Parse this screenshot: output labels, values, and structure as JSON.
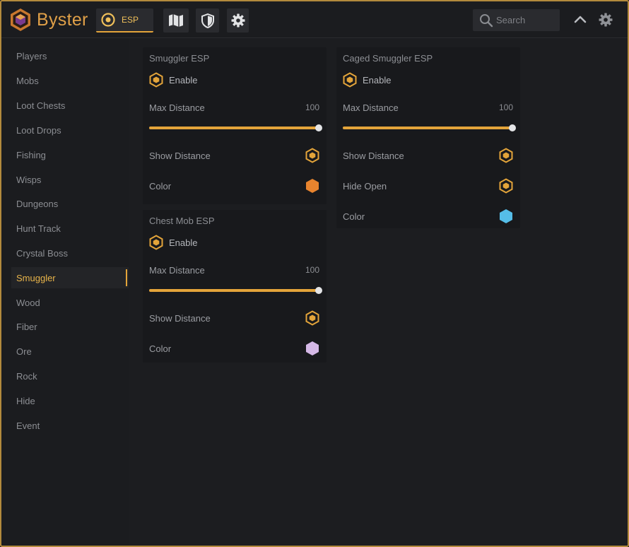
{
  "app": {
    "brand": "Byster"
  },
  "header": {
    "tabs": [
      {
        "label": "ESP",
        "icon": "eye-icon",
        "active": true
      },
      {
        "label": "",
        "icon": "map-icon"
      },
      {
        "label": "",
        "icon": "shield-icon"
      },
      {
        "label": "",
        "icon": "gear-icon"
      }
    ],
    "search": {
      "placeholder": "Search",
      "value": ""
    }
  },
  "sidebar": {
    "items": [
      {
        "label": "Players"
      },
      {
        "label": "Mobs"
      },
      {
        "label": "Loot Chests"
      },
      {
        "label": "Loot Drops"
      },
      {
        "label": "Fishing"
      },
      {
        "label": "Wisps"
      },
      {
        "label": "Dungeons"
      },
      {
        "label": "Hunt Track"
      },
      {
        "label": "Crystal Boss"
      },
      {
        "label": "Smuggler",
        "active": true
      },
      {
        "label": "Wood"
      },
      {
        "label": "Fiber"
      },
      {
        "label": "Ore"
      },
      {
        "label": "Rock"
      },
      {
        "label": "Hide"
      },
      {
        "label": "Event"
      }
    ]
  },
  "panels": {
    "smuggler_esp": {
      "title": "Smuggler ESP",
      "enable_label": "Enable",
      "enabled": true,
      "max_distance_label": "Max Distance",
      "max_distance_value": "100",
      "max_distance_fraction": 1.0,
      "show_distance_label": "Show Distance",
      "show_distance": true,
      "color_label": "Color",
      "color": "#e8842e"
    },
    "chest_mob_esp": {
      "title": "Chest Mob ESP",
      "enable_label": "Enable",
      "enabled": true,
      "max_distance_label": "Max Distance",
      "max_distance_value": "100",
      "max_distance_fraction": 1.0,
      "show_distance_label": "Show Distance",
      "show_distance": true,
      "color_label": "Color",
      "color": "#d4b8e6"
    },
    "caged_smuggler_esp": {
      "title": "Caged Smuggler ESP",
      "enable_label": "Enable",
      "enabled": true,
      "max_distance_label": "Max Distance",
      "max_distance_value": "100",
      "max_distance_fraction": 1.0,
      "show_distance_label": "Show Distance",
      "show_distance": true,
      "hide_open_label": "Hide Open",
      "hide_open": true,
      "color_label": "Color",
      "color": "#55bde8"
    }
  },
  "colors": {
    "accent": "#e3a43a",
    "border": "#b38a3c",
    "background": "#1b1c1f"
  }
}
